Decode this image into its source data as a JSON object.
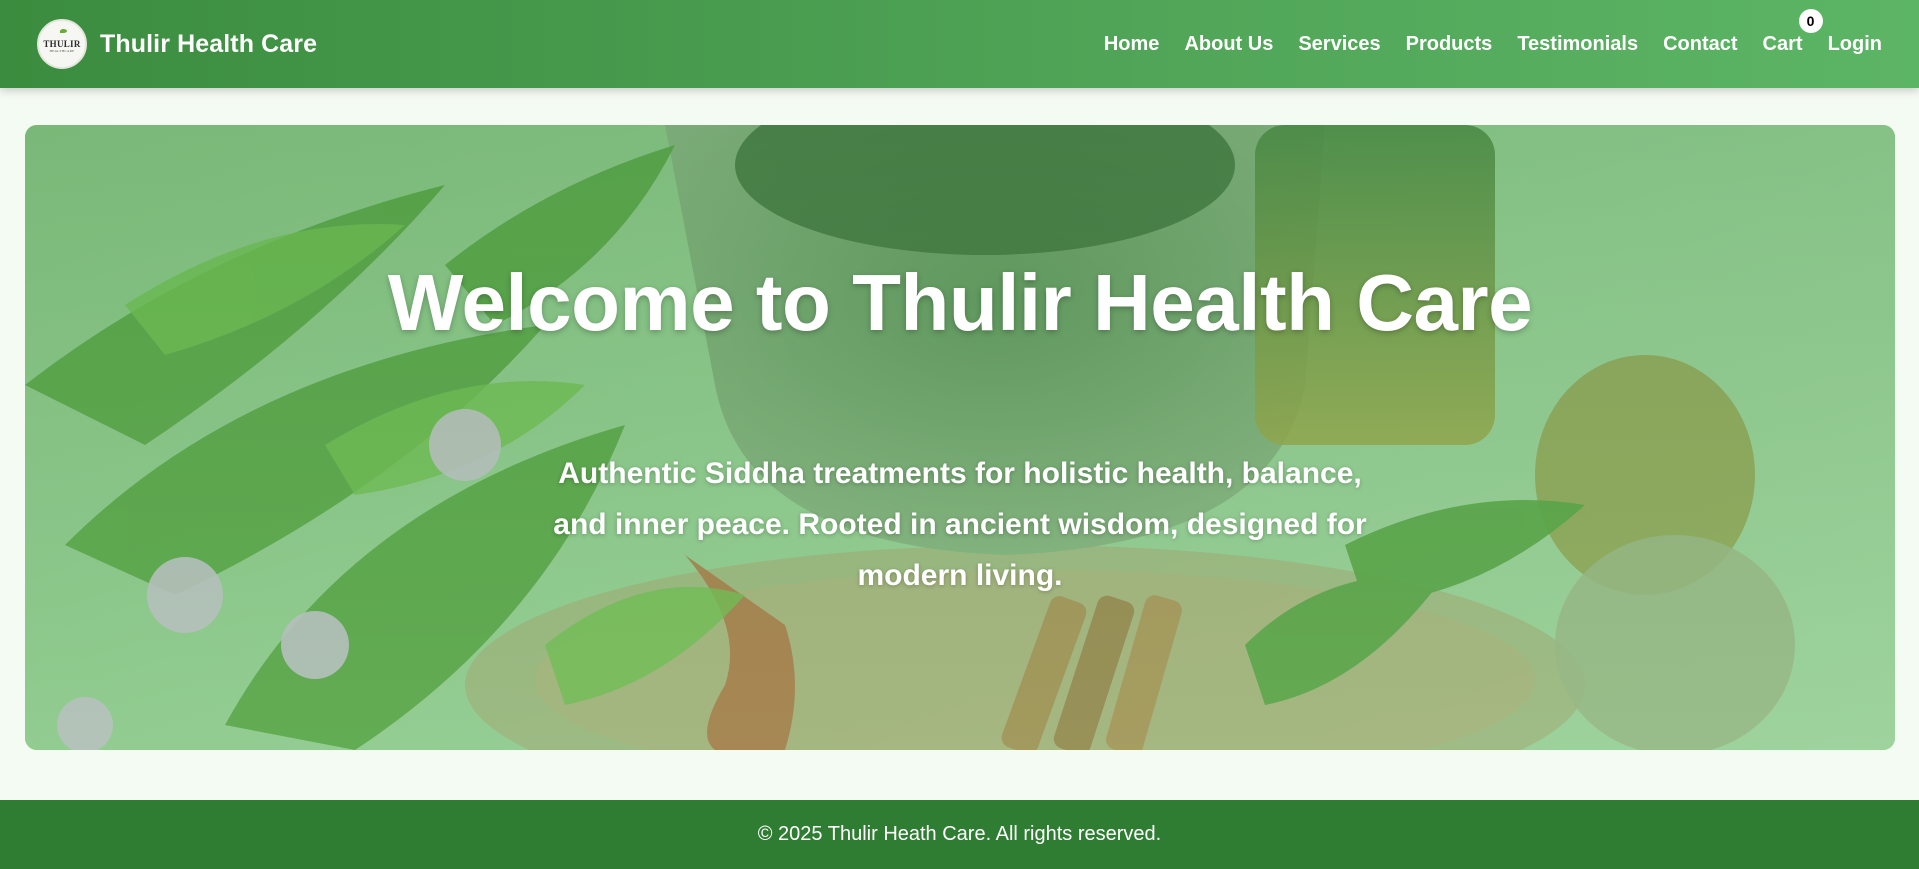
{
  "brand": {
    "logo_text": "THULIR",
    "logo_subtext": "HEALTHCARE",
    "name": "Thulir Health Care"
  },
  "nav": {
    "home": "Home",
    "about": "About Us",
    "services": "Services",
    "products": "Products",
    "testimonials": "Testimonials",
    "contact": "Contact",
    "cart": "Cart",
    "cart_count": "0",
    "login": "Login"
  },
  "hero": {
    "title": "Welcome to Thulir Health Care",
    "subtitle": "Authentic Siddha treatments for holistic health, balance, and inner peace. Rooted in ancient wisdom, designed for modern living."
  },
  "footer": {
    "copyright": "© 2025 Thulir Heath Care. All rights reserved."
  },
  "colors": {
    "nav_start": "#3b8c3e",
    "nav_end": "#5cb565",
    "footer": "#2e7d32",
    "page_bg": "#f4fbf3"
  }
}
